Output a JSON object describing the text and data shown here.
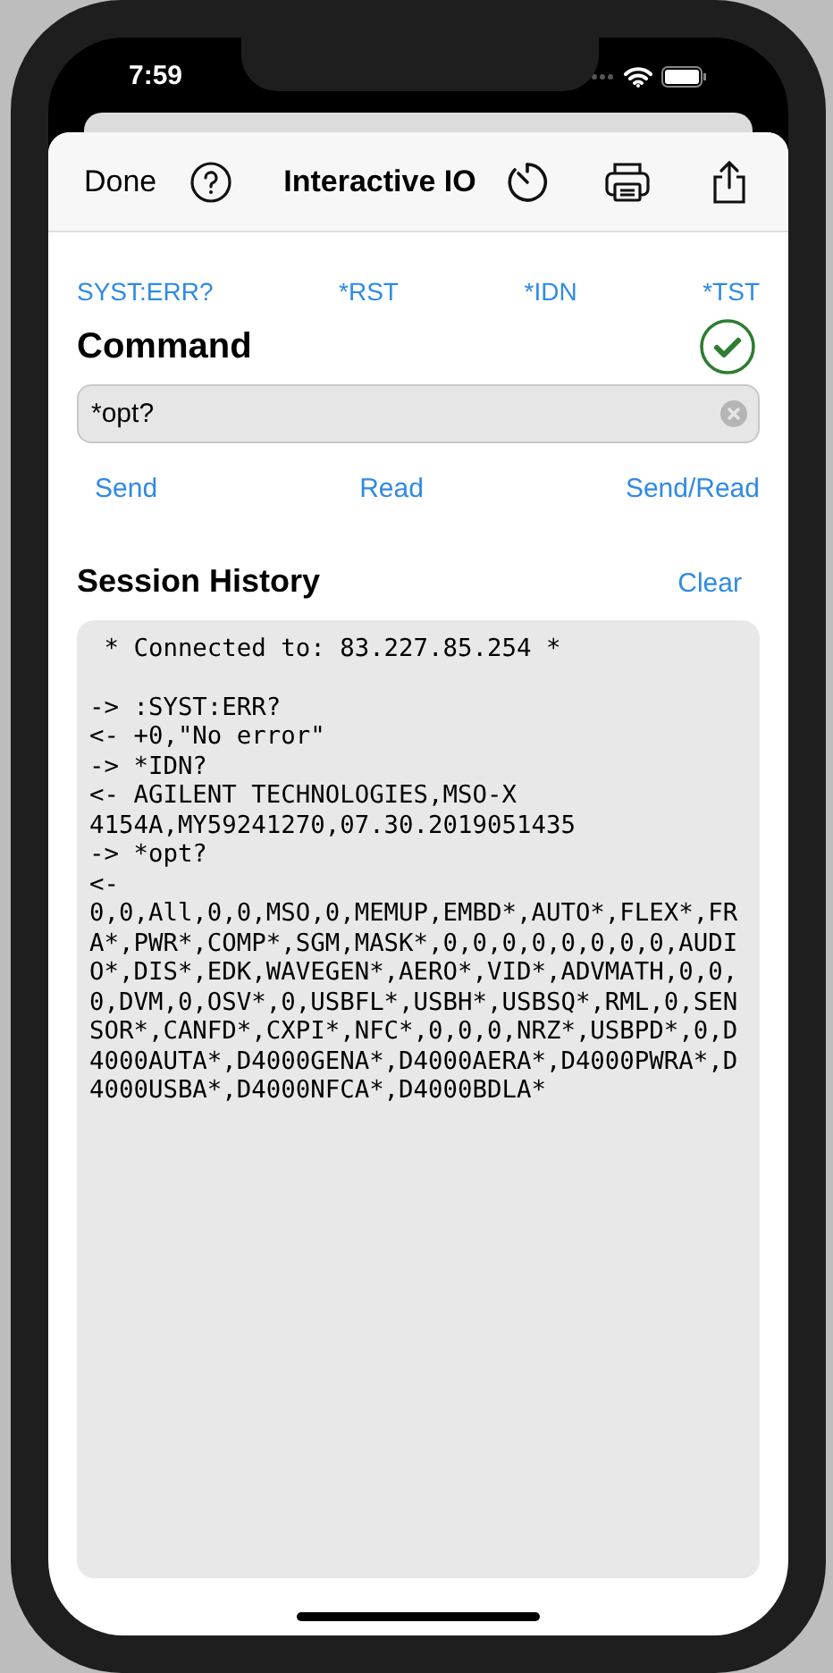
{
  "status_bar": {
    "time": "7:59"
  },
  "nav": {
    "done": "Done",
    "title": "Interactive IO"
  },
  "quick_commands": [
    "SYST:ERR?",
    "*RST",
    "*IDN",
    "*TST"
  ],
  "command": {
    "title": "Command",
    "connected": true,
    "value": "*opt?"
  },
  "actions": [
    "Send",
    "Read",
    "Send/Read"
  ],
  "history": {
    "title": "Session History",
    "clear": "Clear",
    "header": " * Connected to: 83.227.85.254 *",
    "lines": [
      "-> :SYST:ERR?",
      "<- +0,\"No error\"",
      "-> *IDN?",
      "<- AGILENT TECHNOLOGIES,MSO-X",
      "4154A,MY59241270,07.30.2019051435",
      "-> *opt?",
      "<-",
      "0,0,All,0,0,MSO,0,MEMUP,EMBD*,AUTO*,FLEX*,FR",
      "A*,PWR*,COMP*,SGM,MASK*,0,0,0,0,0,0,0,0,AUDI",
      "O*,DIS*,EDK,WAVEGEN*,AERO*,VID*,ADVMATH,0,0,",
      "0,DVM,0,OSV*,0,USBFL*,USBH*,USBSQ*,RML,0,SEN",
      "SOR*,CANFD*,CXPI*,NFC*,0,0,0,NRZ*,USBPD*,0,D",
      "4000AUTA*,D4000GENA*,D4000AERA*,D4000PWRA*,D",
      "4000USBA*,D4000NFCA*,D4000BDLA*"
    ]
  }
}
